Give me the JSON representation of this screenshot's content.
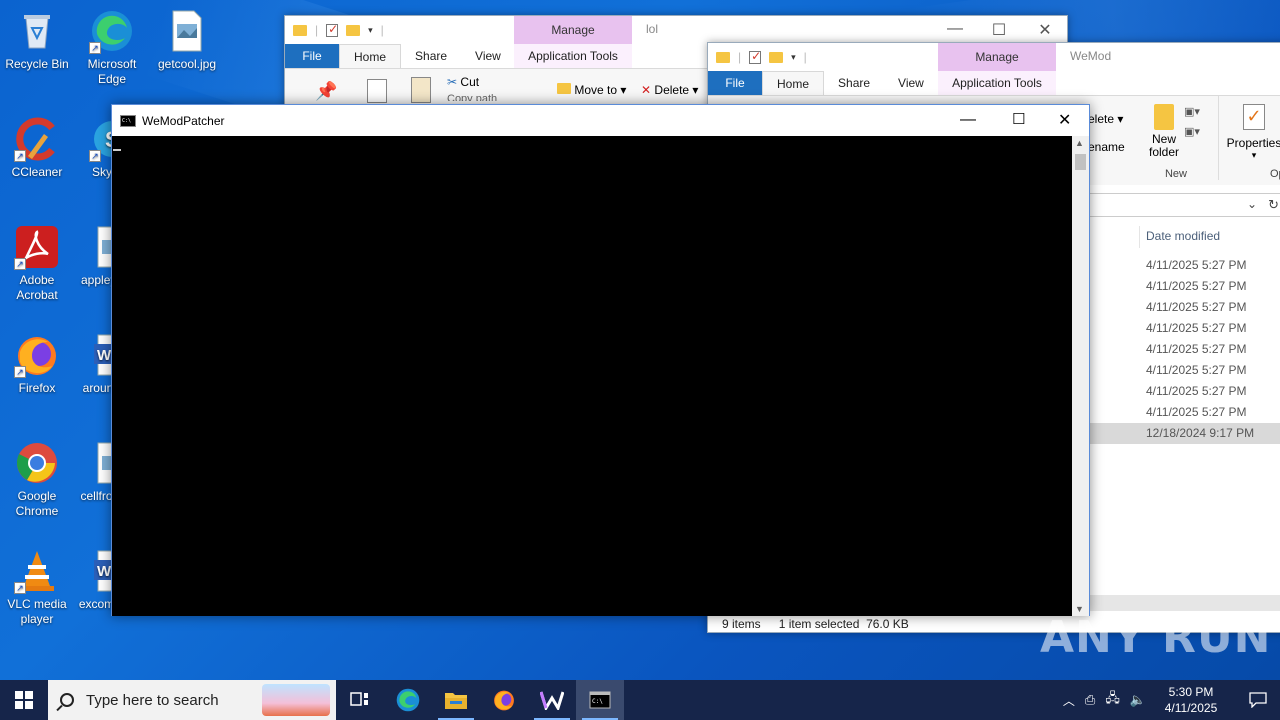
{
  "desktop": {
    "icons": [
      {
        "label": "Recycle Bin",
        "icon": "recycle-bin-icon"
      },
      {
        "label": "Microsoft Edge",
        "icon": "edge-icon"
      },
      {
        "label": "getcool.jpg",
        "icon": "image-file-icon"
      },
      {
        "label": "CCleaner",
        "icon": "ccleaner-icon"
      },
      {
        "label": "Sky",
        "icon": "skype-icon"
      },
      {
        "label": "Adobe Acrobat",
        "icon": "acrobat-icon"
      },
      {
        "label": "appley",
        "icon": "image-file-icon"
      },
      {
        "label": "Firefox",
        "icon": "firefox-icon"
      },
      {
        "label": "aroun",
        "icon": "word-doc-icon"
      },
      {
        "label": "Google Chrome",
        "icon": "chrome-icon"
      },
      {
        "label": "cellfro",
        "icon": "image-file-icon"
      },
      {
        "label": "VLC media player",
        "icon": "vlc-icon"
      },
      {
        "label": "excom",
        "icon": "word-doc-icon"
      }
    ]
  },
  "explorer_back": {
    "title": "lol",
    "manage": "Manage",
    "tabs": {
      "file": "File",
      "home": "Home",
      "share": "Share",
      "view": "View",
      "app_tools": "Application Tools"
    },
    "ribbon": {
      "cut": "Cut",
      "copy_path": "Copy path",
      "move_to": "Move to",
      "delete": "Delete"
    }
  },
  "explorer_front": {
    "title": "WeMod",
    "manage": "Manage",
    "tabs": {
      "file": "File",
      "home": "Home",
      "share": "Share",
      "view": "View",
      "app_tools": "Application Tools"
    },
    "ribbon": {
      "delete": "elete",
      "rename": "ename",
      "new_folder_line1": "New",
      "new_folder_line2": "folder",
      "new_group": "New",
      "properties": "Properties",
      "open_group": "Op"
    },
    "column_header": "Date modified",
    "rows": [
      "4/11/2025 5:27 PM",
      "4/11/2025 5:27 PM",
      "4/11/2025 5:27 PM",
      "4/11/2025 5:27 PM",
      "4/11/2025 5:27 PM",
      "4/11/2025 5:27 PM",
      "4/11/2025 5:27 PM",
      "4/11/2025 5:27 PM",
      "12/18/2024 9:17 PM"
    ],
    "selected_row": 8,
    "status": {
      "items": "9 items",
      "selected": "1 item selected",
      "size": "76.0 KB"
    }
  },
  "console": {
    "title": "WeModPatcher",
    "background": "#000000"
  },
  "taskbar": {
    "search_placeholder": "Type here to search",
    "time": "5:30 PM",
    "date": "4/11/2025"
  },
  "watermark": "ANY RUN"
}
